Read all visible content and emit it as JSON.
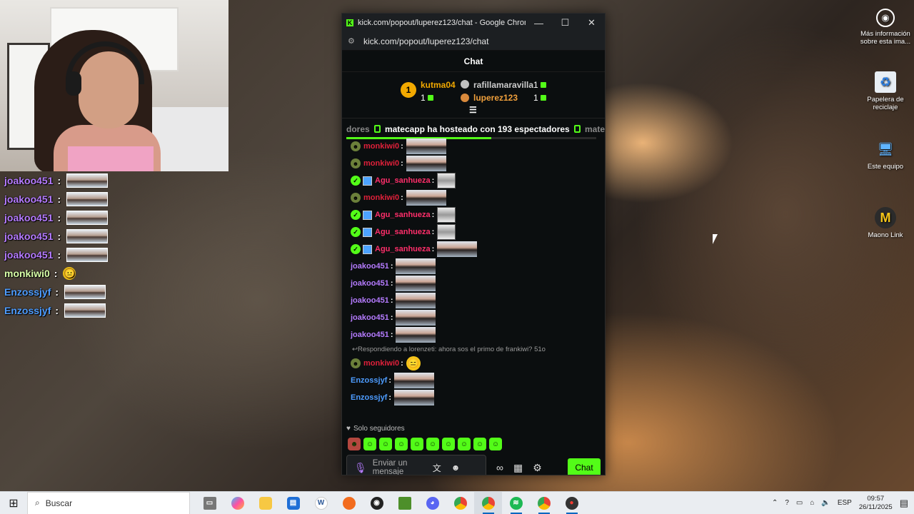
{
  "overlay_chat": [
    {
      "user": "joakoo451",
      "color": "#b57bff",
      "content": "emote"
    },
    {
      "user": "joakoo451",
      "color": "#b57bff",
      "content": "emote"
    },
    {
      "user": "joakoo451",
      "color": "#b57bff",
      "content": "emote"
    },
    {
      "user": "joakoo451",
      "color": "#b57bff",
      "content": "emote"
    },
    {
      "user": "joakoo451",
      "color": "#b57bff",
      "content": "emote"
    },
    {
      "user": "monkiwi0",
      "color": "#d8ffa8",
      "content": "emoji"
    },
    {
      "user": "Enzossjyf",
      "color": "#4d9cff",
      "content": "emote"
    },
    {
      "user": "Enzossjyf",
      "color": "#4d9cff",
      "content": "emote"
    }
  ],
  "window": {
    "title": "kick.com/popout/luperez123/chat - Google Chrome",
    "url": "kick.com/popout/luperez123/chat",
    "minimize": "—",
    "maximize": "☐",
    "close": "✕"
  },
  "chat": {
    "header": "Chat",
    "leaderboard": {
      "first": {
        "rank": "1",
        "name": "kutma04",
        "count": "1"
      },
      "second": {
        "name": "rafillamaravilla",
        "count": "1"
      },
      "third": {
        "name": "luperez123",
        "count": "1"
      }
    },
    "host_banner": {
      "prefix": "dores",
      "user": "matecapp",
      "text_a": " ha hosteado con ",
      "viewers": "193",
      "text_b": " espectadores",
      "suffix": "mate",
      "progress": 0.58
    },
    "messages": [
      {
        "badges": [
          "bot"
        ],
        "user": "monkiwi0",
        "color": "#e0203a",
        "content": "emote"
      },
      {
        "badges": [
          "bot"
        ],
        "user": "monkiwi0",
        "color": "#e0203a",
        "content": "emote"
      },
      {
        "badges": [
          "verified",
          "sub"
        ],
        "user": "Agu_sanhueza",
        "color": "#ff2e6a",
        "content": "small"
      },
      {
        "badges": [
          "bot"
        ],
        "user": "monkiwi0",
        "color": "#e0203a",
        "content": "emote"
      },
      {
        "badges": [
          "verified",
          "sub"
        ],
        "user": "Agu_sanhueza",
        "color": "#ff2e6a",
        "content": "small"
      },
      {
        "badges": [
          "verified",
          "sub"
        ],
        "user": "Agu_sanhueza",
        "color": "#ff2e6a",
        "content": "small"
      },
      {
        "badges": [
          "verified",
          "sub"
        ],
        "user": "Agu_sanhueza",
        "color": "#ff2e6a",
        "content": "emote"
      },
      {
        "badges": [],
        "user": "joakoo451",
        "color": "#b57bff",
        "content": "emote"
      },
      {
        "badges": [],
        "user": "joakoo451",
        "color": "#b57bff",
        "content": "emote"
      },
      {
        "badges": [],
        "user": "joakoo451",
        "color": "#b57bff",
        "content": "emote"
      },
      {
        "badges": [],
        "user": "joakoo451",
        "color": "#b57bff",
        "content": "emote"
      },
      {
        "badges": [],
        "user": "joakoo451",
        "color": "#b57bff",
        "content": "emote"
      }
    ],
    "reply_text": "Respondiendo a lorenzeti: ahora sos el primo de frankiwi? 51o",
    "messages_after": [
      {
        "badges": [
          "bot"
        ],
        "user": "monkiwi0",
        "color": "#e0203a",
        "content": "emoji"
      },
      {
        "badges": [],
        "user": "Enzossjyf",
        "color": "#4d9cff",
        "content": "emote"
      },
      {
        "badges": [],
        "user": "Enzossjyf",
        "color": "#4d9cff",
        "content": "emote"
      }
    ],
    "followers_only": "Solo seguidores",
    "input_placeholder": "Enviar un mensaje",
    "send_label": "Chat"
  },
  "desktop_icons": [
    {
      "label": "Más información sobre esta ima...",
      "icon": "info-camera-icon"
    },
    {
      "label": "Papelera de reciclaje",
      "icon": "recycle-bin-icon"
    },
    {
      "label": "Este equipo",
      "icon": "computer-icon"
    },
    {
      "label": "Maono Link",
      "icon": "maono-link-icon"
    }
  ],
  "taskbar": {
    "search_placeholder": "Buscar",
    "language": "ESP",
    "time": "09:57",
    "date": "26/11/2025",
    "apps": [
      "task-view",
      "copilot",
      "file-explorer",
      "store",
      "word",
      "app-orange",
      "obs",
      "minecraft",
      "discord",
      "chrome",
      "chrome-profile",
      "spotify",
      "chrome-profile-2",
      "app-red"
    ]
  },
  "colors": {
    "kick_green": "#53fc18",
    "chat_bg": "#0b0e0f"
  }
}
